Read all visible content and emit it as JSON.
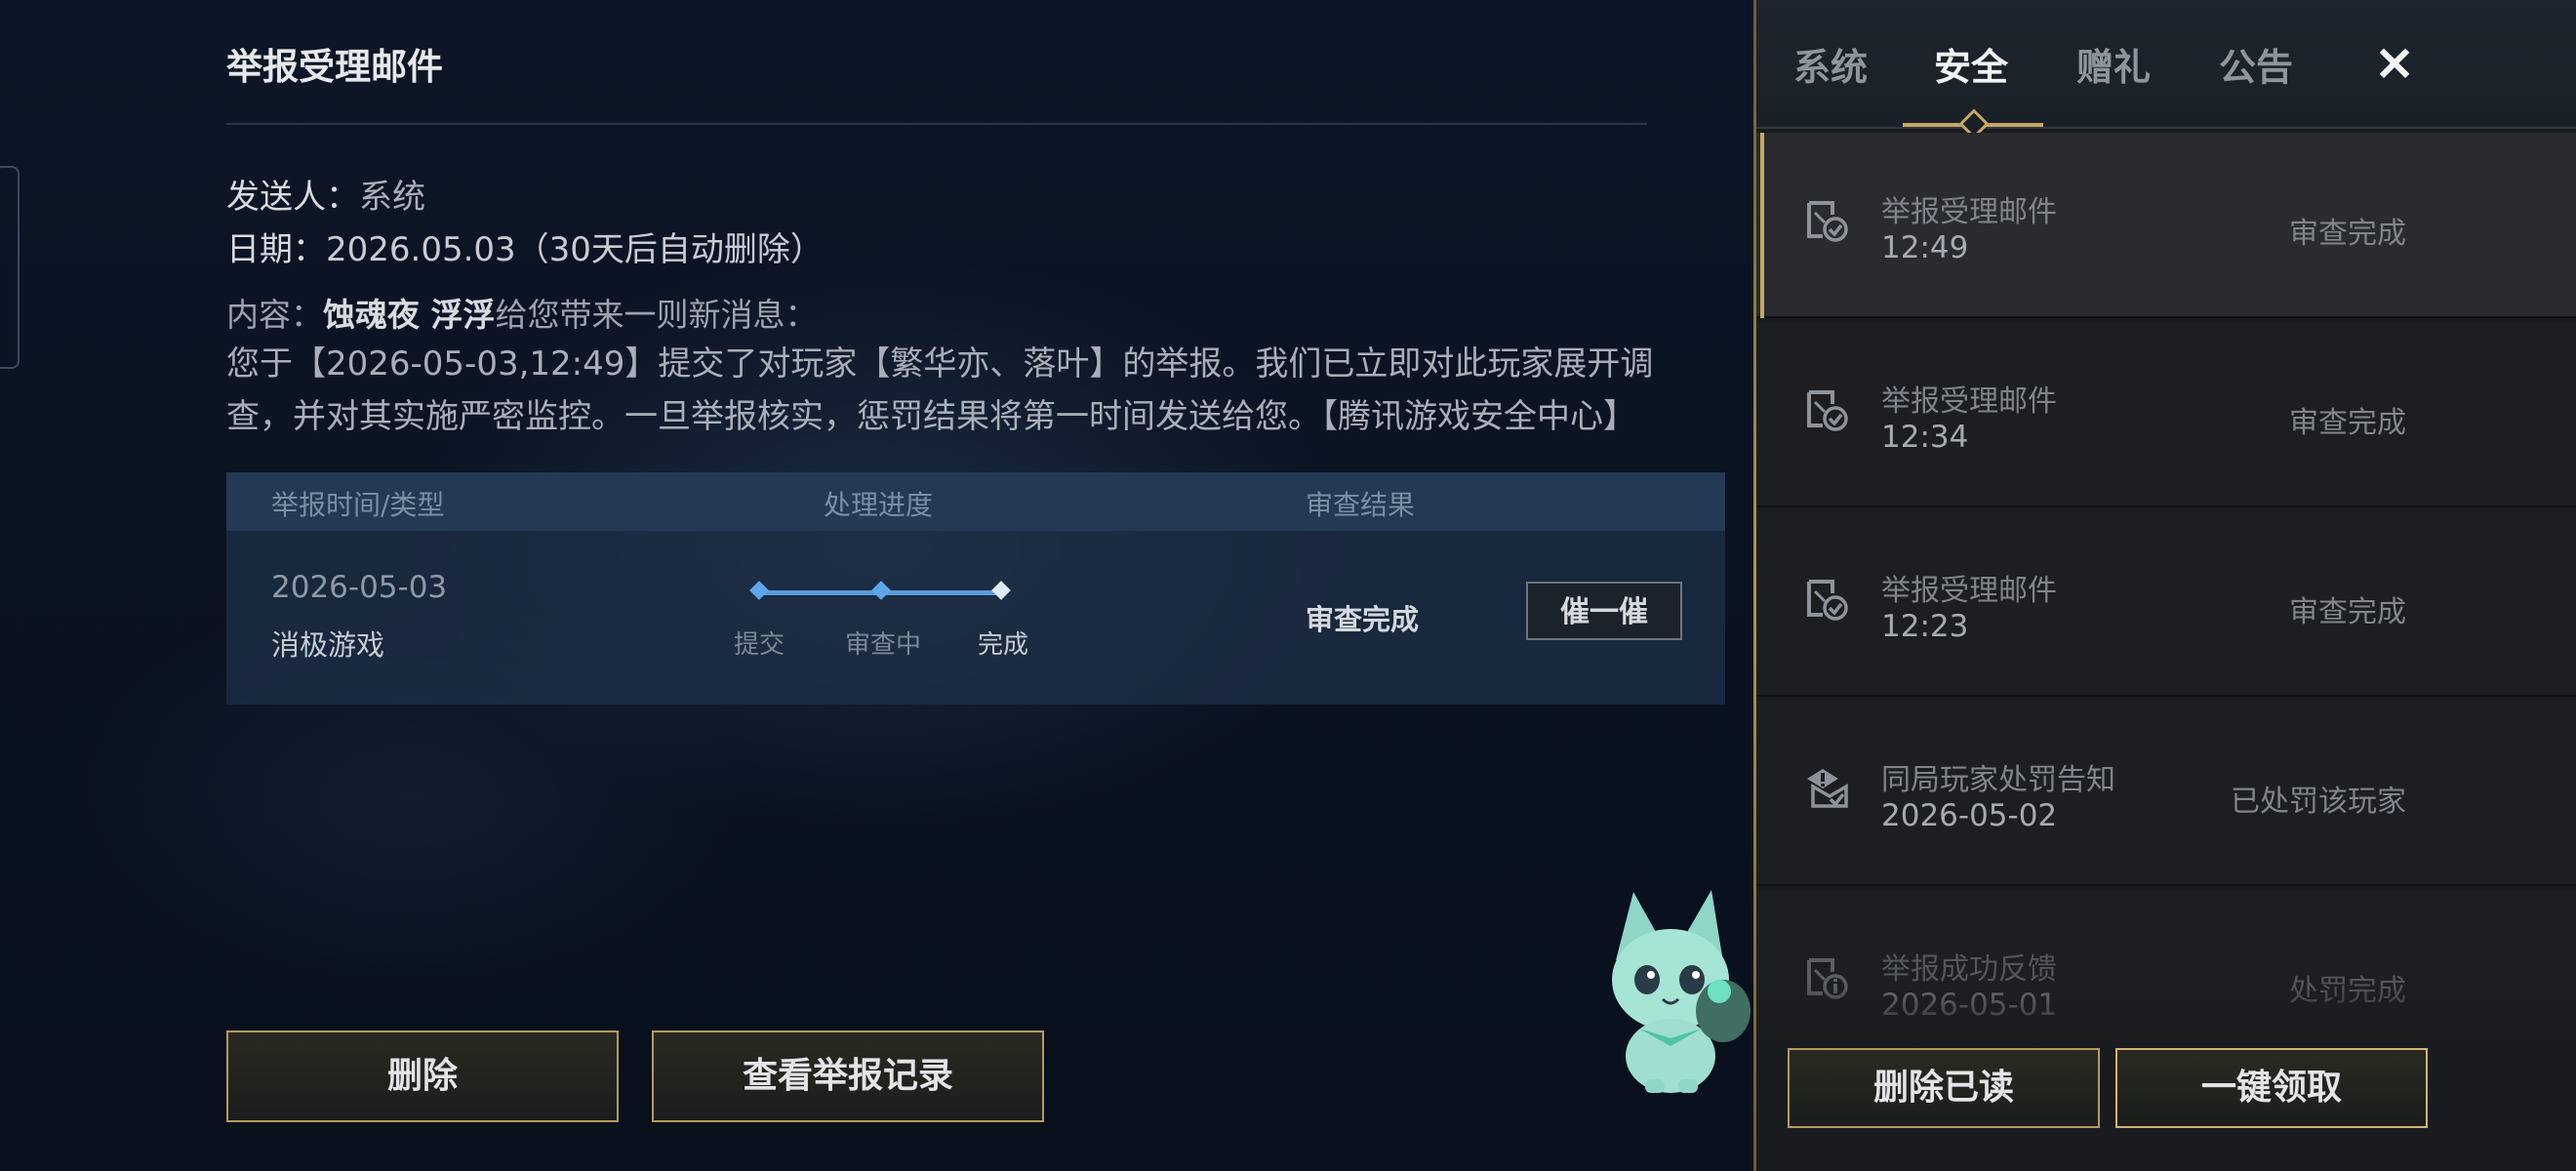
{
  "detail": {
    "title": "举报受理邮件",
    "sender_label": "发送人：",
    "sender_value": "系统",
    "date_label": "日期：",
    "date_value": "2026.05.03（30天后自动删除）",
    "content_prefix": "内容：",
    "content_sender": "蚀魂夜 浮浮",
    "content_suffix": "给您带来一则新消息：",
    "body": "您于【2026-05-03,12:49】提交了对玩家【繁华亦、落叶】的举报。我们已立即对此玩家展开调查，并对其实施严密监控。一旦举报核实，惩罚结果将第一时间发送给您。【腾讯游戏安全中心】"
  },
  "report_table": {
    "headers": {
      "time_type": "举报时间/类型",
      "progress": "处理进度",
      "result": "审查结果"
    },
    "row": {
      "date": "2026-05-03",
      "type": "消极游戏",
      "steps": [
        "提交",
        "审查中",
        "完成"
      ],
      "progress_step": 3,
      "result": "审查完成",
      "urge_label": "催一催"
    }
  },
  "actions": {
    "delete": "删除",
    "view_history": "查看举报记录"
  },
  "tabs": [
    {
      "label": "系统"
    },
    {
      "label": "安全",
      "active": true
    },
    {
      "label": "赠礼"
    },
    {
      "label": "公告"
    }
  ],
  "close_icon": "×",
  "mail_list": [
    {
      "name": "举报受理邮件",
      "time": "12:49",
      "status": "审查完成",
      "icon": "shield-check-icon",
      "selected": true
    },
    {
      "name": "举报受理邮件",
      "time": "12:34",
      "status": "审查完成",
      "icon": "shield-check-icon"
    },
    {
      "name": "举报受理邮件",
      "time": "12:23",
      "status": "审查完成",
      "icon": "shield-check-icon"
    },
    {
      "name": "同局玩家处罚告知",
      "time": "2026-05-02",
      "status": "已处罚该玩家",
      "icon": "warning-envelope-icon"
    },
    {
      "name": "举报成功反馈",
      "time": "2026-05-01",
      "status": "处罚完成",
      "icon": "shield-info-icon"
    }
  ],
  "panel_actions": {
    "delete_read": "删除已读",
    "claim_all": "一键领取"
  },
  "colors": {
    "accent_gold": "#c9a862",
    "progress_blue": "#5a9ad6",
    "panel_bg": "#1a1b1e"
  }
}
